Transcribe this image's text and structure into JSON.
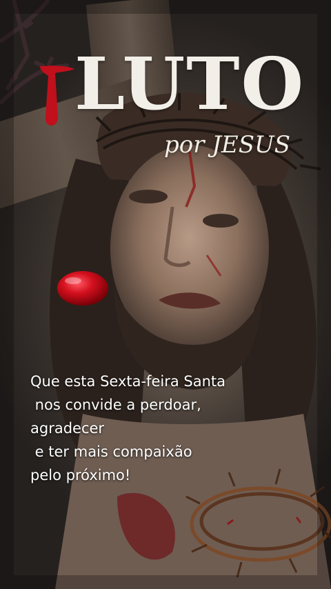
{
  "poster": {
    "title": "LUTO",
    "subtitle": "por JESUS",
    "message_lines": [
      "Que esta Sexta-feira Santa",
      " nos convide a perdoar,",
      "agradecer",
      " e ter mais compaixão",
      "pelo próximo!"
    ]
  },
  "colors": {
    "blood": "#c0101c",
    "text": "#f2efe8"
  }
}
